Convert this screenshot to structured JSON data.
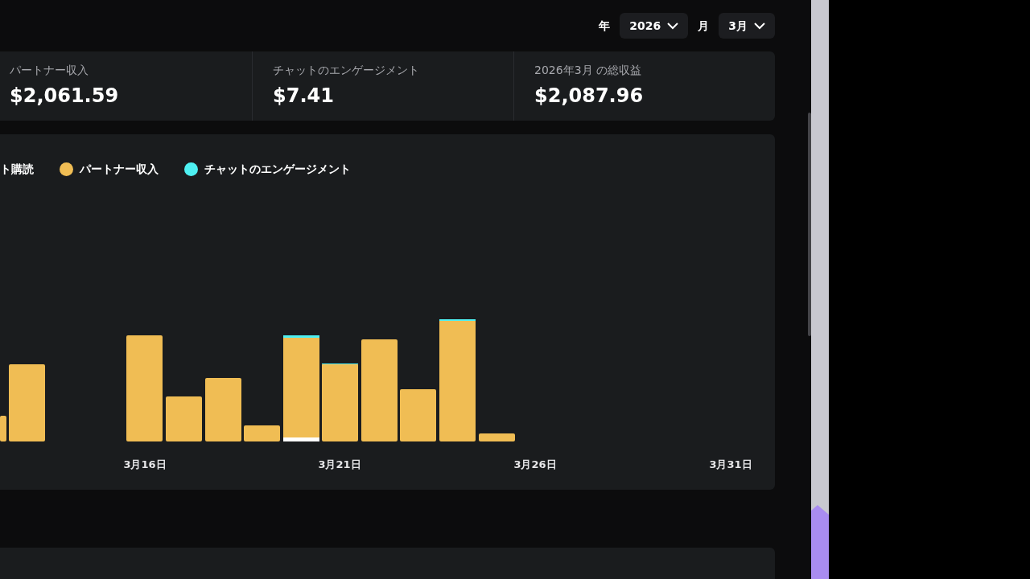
{
  "filters": [
    {
      "label": "年",
      "value": "2026"
    },
    {
      "label": "月",
      "value": "3月"
    }
  ],
  "stats": [
    {
      "label": "パートナー収入",
      "value": "$2,061.59"
    },
    {
      "label": "チャットのエンゲージメント",
      "value": "$7.41"
    },
    {
      "label": "2026年3月 の総収益",
      "value": "$2,087.96"
    }
  ],
  "chart": {
    "legend": [
      {
        "label": "ト購読"
      },
      {
        "label": "パートナー収入",
        "color": "#f0bd54"
      },
      {
        "label": "チャットのエンゲージメント",
        "color": "#4ef0f2"
      }
    ],
    "x_labels": [
      "3月16日",
      "3月21日",
      "3月26日",
      "3月31日"
    ]
  }
}
